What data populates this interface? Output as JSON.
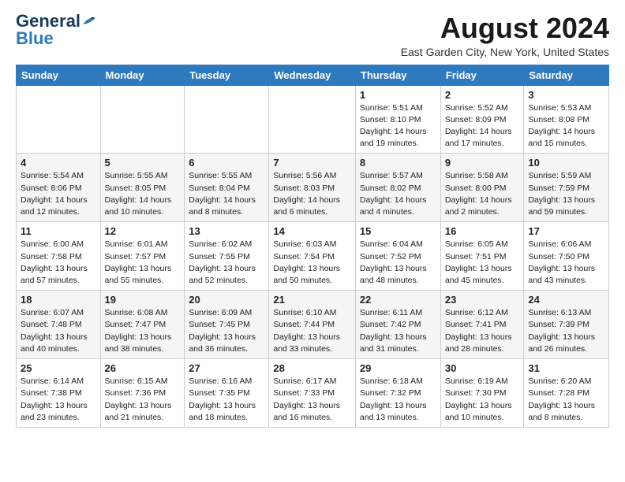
{
  "logo": {
    "part1": "General",
    "part2": "Blue"
  },
  "title": "August 2024",
  "location": "East Garden City, New York, United States",
  "weekdays": [
    "Sunday",
    "Monday",
    "Tuesday",
    "Wednesday",
    "Thursday",
    "Friday",
    "Saturday"
  ],
  "weeks": [
    [
      {
        "day": "",
        "info": ""
      },
      {
        "day": "",
        "info": ""
      },
      {
        "day": "",
        "info": ""
      },
      {
        "day": "",
        "info": ""
      },
      {
        "day": "1",
        "info": "Sunrise: 5:51 AM\nSunset: 8:10 PM\nDaylight: 14 hours\nand 19 minutes."
      },
      {
        "day": "2",
        "info": "Sunrise: 5:52 AM\nSunset: 8:09 PM\nDaylight: 14 hours\nand 17 minutes."
      },
      {
        "day": "3",
        "info": "Sunrise: 5:53 AM\nSunset: 8:08 PM\nDaylight: 14 hours\nand 15 minutes."
      }
    ],
    [
      {
        "day": "4",
        "info": "Sunrise: 5:54 AM\nSunset: 8:06 PM\nDaylight: 14 hours\nand 12 minutes."
      },
      {
        "day": "5",
        "info": "Sunrise: 5:55 AM\nSunset: 8:05 PM\nDaylight: 14 hours\nand 10 minutes."
      },
      {
        "day": "6",
        "info": "Sunrise: 5:55 AM\nSunset: 8:04 PM\nDaylight: 14 hours\nand 8 minutes."
      },
      {
        "day": "7",
        "info": "Sunrise: 5:56 AM\nSunset: 8:03 PM\nDaylight: 14 hours\nand 6 minutes."
      },
      {
        "day": "8",
        "info": "Sunrise: 5:57 AM\nSunset: 8:02 PM\nDaylight: 14 hours\nand 4 minutes."
      },
      {
        "day": "9",
        "info": "Sunrise: 5:58 AM\nSunset: 8:00 PM\nDaylight: 14 hours\nand 2 minutes."
      },
      {
        "day": "10",
        "info": "Sunrise: 5:59 AM\nSunset: 7:59 PM\nDaylight: 13 hours\nand 59 minutes."
      }
    ],
    [
      {
        "day": "11",
        "info": "Sunrise: 6:00 AM\nSunset: 7:58 PM\nDaylight: 13 hours\nand 57 minutes."
      },
      {
        "day": "12",
        "info": "Sunrise: 6:01 AM\nSunset: 7:57 PM\nDaylight: 13 hours\nand 55 minutes."
      },
      {
        "day": "13",
        "info": "Sunrise: 6:02 AM\nSunset: 7:55 PM\nDaylight: 13 hours\nand 52 minutes."
      },
      {
        "day": "14",
        "info": "Sunrise: 6:03 AM\nSunset: 7:54 PM\nDaylight: 13 hours\nand 50 minutes."
      },
      {
        "day": "15",
        "info": "Sunrise: 6:04 AM\nSunset: 7:52 PM\nDaylight: 13 hours\nand 48 minutes."
      },
      {
        "day": "16",
        "info": "Sunrise: 6:05 AM\nSunset: 7:51 PM\nDaylight: 13 hours\nand 45 minutes."
      },
      {
        "day": "17",
        "info": "Sunrise: 6:06 AM\nSunset: 7:50 PM\nDaylight: 13 hours\nand 43 minutes."
      }
    ],
    [
      {
        "day": "18",
        "info": "Sunrise: 6:07 AM\nSunset: 7:48 PM\nDaylight: 13 hours\nand 40 minutes."
      },
      {
        "day": "19",
        "info": "Sunrise: 6:08 AM\nSunset: 7:47 PM\nDaylight: 13 hours\nand 38 minutes."
      },
      {
        "day": "20",
        "info": "Sunrise: 6:09 AM\nSunset: 7:45 PM\nDaylight: 13 hours\nand 36 minutes."
      },
      {
        "day": "21",
        "info": "Sunrise: 6:10 AM\nSunset: 7:44 PM\nDaylight: 13 hours\nand 33 minutes."
      },
      {
        "day": "22",
        "info": "Sunrise: 6:11 AM\nSunset: 7:42 PM\nDaylight: 13 hours\nand 31 minutes."
      },
      {
        "day": "23",
        "info": "Sunrise: 6:12 AM\nSunset: 7:41 PM\nDaylight: 13 hours\nand 28 minutes."
      },
      {
        "day": "24",
        "info": "Sunrise: 6:13 AM\nSunset: 7:39 PM\nDaylight: 13 hours\nand 26 minutes."
      }
    ],
    [
      {
        "day": "25",
        "info": "Sunrise: 6:14 AM\nSunset: 7:38 PM\nDaylight: 13 hours\nand 23 minutes."
      },
      {
        "day": "26",
        "info": "Sunrise: 6:15 AM\nSunset: 7:36 PM\nDaylight: 13 hours\nand 21 minutes."
      },
      {
        "day": "27",
        "info": "Sunrise: 6:16 AM\nSunset: 7:35 PM\nDaylight: 13 hours\nand 18 minutes."
      },
      {
        "day": "28",
        "info": "Sunrise: 6:17 AM\nSunset: 7:33 PM\nDaylight: 13 hours\nand 16 minutes."
      },
      {
        "day": "29",
        "info": "Sunrise: 6:18 AM\nSunset: 7:32 PM\nDaylight: 13 hours\nand 13 minutes."
      },
      {
        "day": "30",
        "info": "Sunrise: 6:19 AM\nSunset: 7:30 PM\nDaylight: 13 hours\nand 10 minutes."
      },
      {
        "day": "31",
        "info": "Sunrise: 6:20 AM\nSunset: 7:28 PM\nDaylight: 13 hours\nand 8 minutes."
      }
    ]
  ]
}
